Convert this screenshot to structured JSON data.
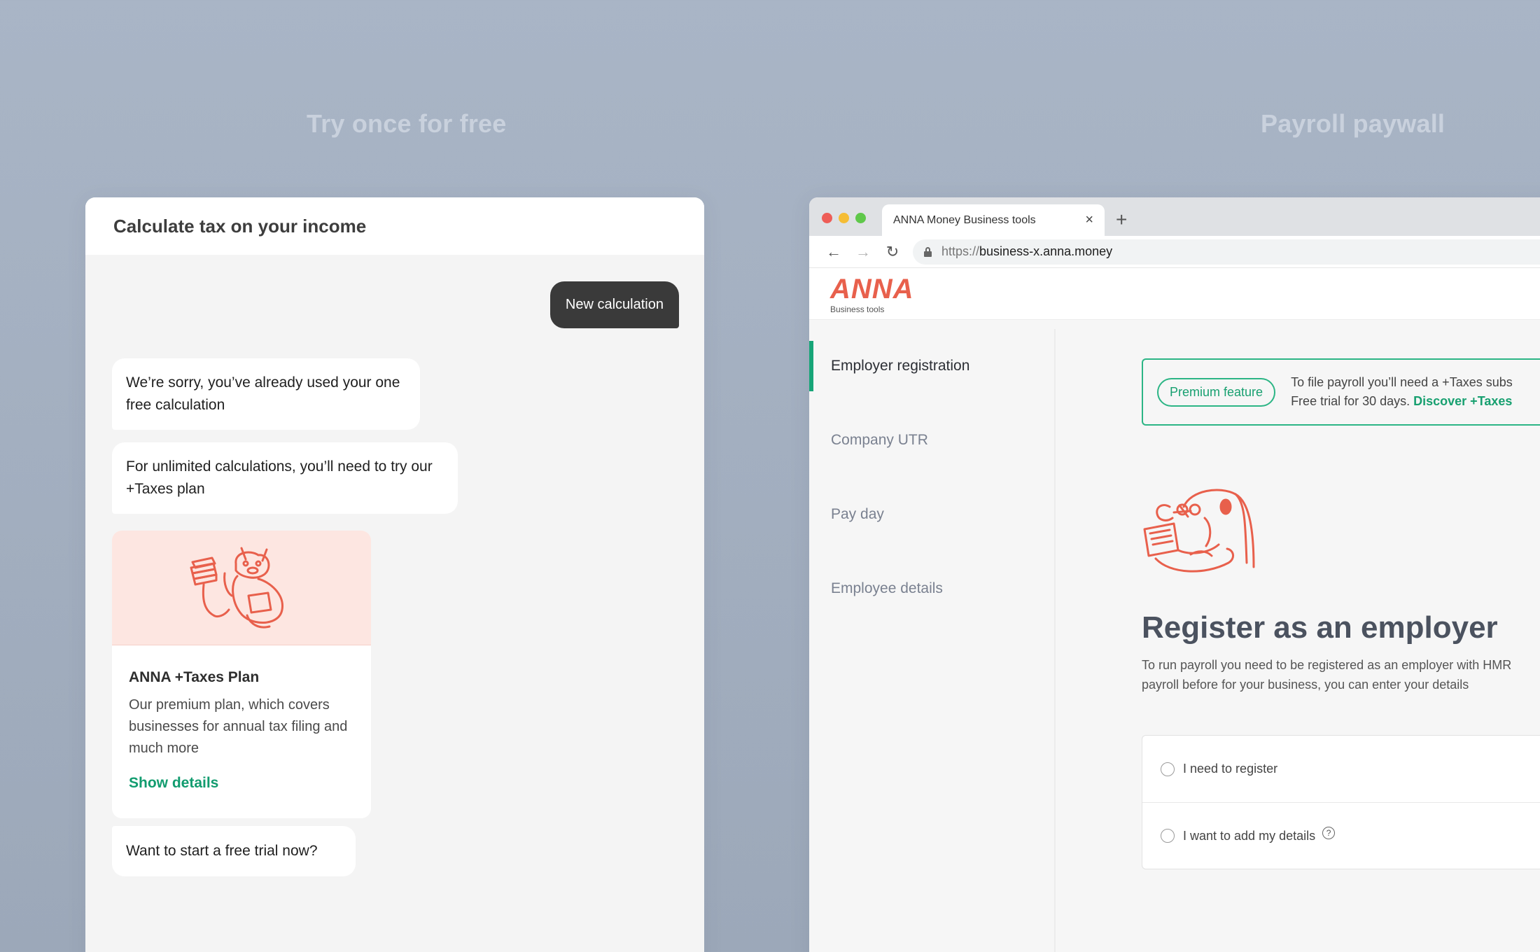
{
  "sections": {
    "left_title": "Try once for free",
    "right_title": "Payroll paywall"
  },
  "chat": {
    "header_title": "Calculate tax on your income",
    "outgoing_message": "New calculation",
    "message_sorry": "We’re sorry, you’ve already used your one free calculation",
    "message_unlimited": "For unlimited calculations, you’ll need to try our +Taxes plan",
    "plan_card": {
      "illustration": "cat-with-documents-illustration",
      "title": "ANNA +Taxes Plan",
      "description": "Our premium plan, which covers businesses for annual tax filing and much more",
      "link_label": "Show details"
    },
    "message_trial": "Want to start a free trial now?"
  },
  "browser": {
    "tab_title": "ANNA Money Business tools",
    "tab_close": "×",
    "new_tab": "+",
    "url_protocol": "https://",
    "url_host": "business-x.anna.money",
    "icons": [
      "back-arrow-icon",
      "forward-arrow-icon",
      "reload-icon",
      "lock-icon"
    ],
    "logo_text": "ANNA",
    "logo_subtitle": "Business tools",
    "sidebar": {
      "items": [
        {
          "label": "Employer registration",
          "active": true
        },
        {
          "label": "Company UTR",
          "active": false
        },
        {
          "label": "Pay day",
          "active": false
        },
        {
          "label": "Employee details",
          "active": false
        }
      ]
    },
    "banner": {
      "pill_label": "Premium feature",
      "line1": "To file payroll you’ll need a +Taxes subs",
      "line2_prefix": "Free trial for 30 days. ",
      "line2_link": "Discover +Taxes"
    },
    "register_title": "Register as an employer",
    "register_desc_line1": "To run payroll you need to be registered as an employer with HMR",
    "register_desc_line2": "payroll before for your business, you can enter your details",
    "options": [
      {
        "label": "I need to register",
        "help": false
      },
      {
        "label": "I want to add my details",
        "help": true
      }
    ],
    "help_glyph": "?"
  },
  "colors": {
    "accent_green": "#17a578",
    "brand_coral": "#e8604c",
    "chat_bubble_dark": "#3a3a3a",
    "background": "#a3afc0"
  }
}
